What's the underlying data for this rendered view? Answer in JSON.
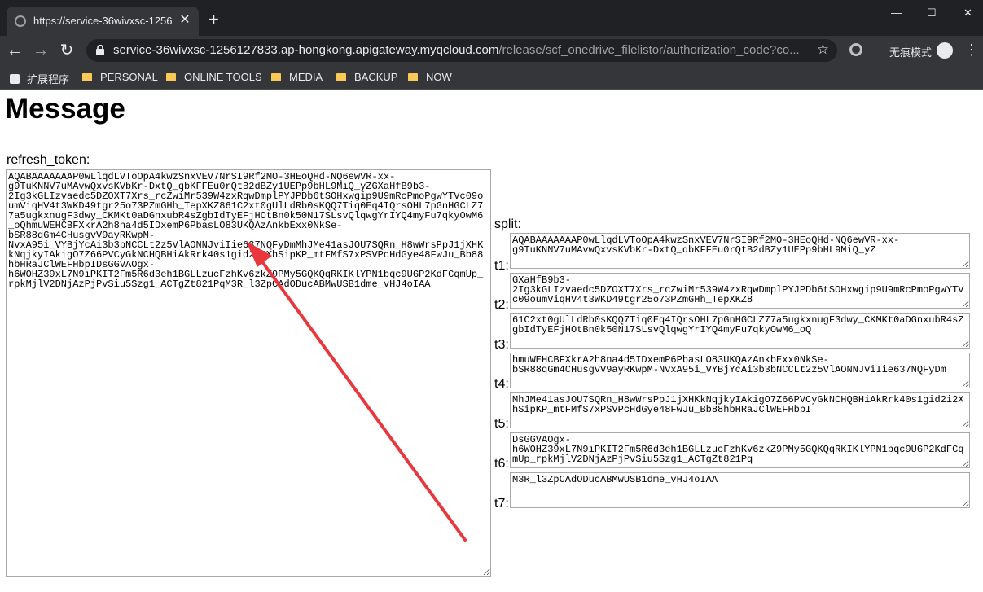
{
  "browser": {
    "tab_title": "https://service-36wivxsc-1256",
    "url_host": "service-36wivxsc-1256127833.ap-hongkong.apigateway.myqcloud.com",
    "url_path": "/release/scf_onedrive_filelistor/authorization_code?co...",
    "incognito_label": "无痕模式",
    "bookmarks": [
      "扩展程序",
      "PERSONAL",
      "ONLINE TOOLS",
      "MEDIA",
      "BACKUP",
      "NOW"
    ]
  },
  "page": {
    "heading": "Message",
    "refresh_label": "refresh_token:",
    "refresh_token": "AQABAAAAAAAP0wLlqdLVToOpA4kwzSnxVEV7NrSI9Rf2MO-3HEoQHd-NQ6ewVR-xx-g9TuKNNV7uMAvwQxvsKVbKr-DxtQ_qbKFFEu0rQtB2dBZy1UEPp9bHL9MiQ_yZGXaHfB9b3-2Ig3kGLIzvaedc5DZOXT7Xrs_rcZwiMr539W4zxRqwDmplPYJPDb6tSOHxwgip9U9mRcPmoPgwYTVc09oumViqHV4t3WKD49tgr25o73PZmGHh_TepXKZ861C2xt0gUlLdRb0sKQQ7Tiq0Eq4IQrsOHL7pGnHGCLZ77a5ugkxnugF3dwy_CKMKt0aDGnxubR4sZgbIdTyEFjHOtBn0k50N17SLsvQlqwgYrIYQ4myFu7qkyOwM6_oQhmuWEHCBFXkrA2h8na4d5IDxemP6PbasLO83UKQAzAnkbExx0NkSe-bSR88qGm4CHusgvV9ayRKwpM-NvxA95i_VYBjYcAi3b3bNCCLt2z5VlAONNJviIie637NQFyDmMhJMe41asJOU7SQRn_H8wWrsPpJ1jXHKkNqjkyIAkigO7Z66PVCyGkNCHQBHiAkRrk40s1gid2i2XhSipKP_mtFMfS7xPSVPcHdGye48FwJu_Bb88hbHRaJClWEFHbpIDsGGVAOgx-h6WOHZ39xL7N9iPKIT2Fm5R6d3eh1BGLLzucFzhKv6zkZ9PMy5GQKQqRKIKlYPN1bqc9UGP2KdFCqmUp_rpkMjlV2DNjAzPjPvSiu5Szg1_ACTgZt821PqM3R_l3ZpCAdODucABMwUSB1dme_vHJ4oIAA",
    "split_label": "split:",
    "splits": [
      {
        "label": "t1:",
        "value": "AQABAAAAAAAP0wLlqdLVToOpA4kwzSnxVEV7NrSI9Rf2MO-3HEoQHd-NQ6ewVR-xx-g9TuKNNV7uMAvwQxvsKVbKr-DxtQ_qbKFFEu0rQtB2dBZy1UEPp9bHL9MiQ_yZ"
      },
      {
        "label": "t2:",
        "value": "GXaHfB9b3-2Ig3kGLIzvaedc5DZOXT7Xrs_rcZwiMr539W4zxRqwDmplPYJPDb6tSOHxwgip9U9mRcPmoPgwYTVc09oumViqHV4t3WKD49tgr25o73PZmGHh_TepXKZ8"
      },
      {
        "label": "t3:",
        "value": "61C2xt0gUlLdRb0sKQQ7Tiq0Eq4IQrsOHL7pGnHGCLZ77a5ugkxnugF3dwy_CKMKt0aDGnxubR4sZgbIdTyEFjHOtBn0k50N17SLsvQlqwgYrIYQ4myFu7qkyOwM6_oQ"
      },
      {
        "label": "t4:",
        "value": "hmuWEHCBFXkrA2h8na4d5IDxemP6PbasLO83UKQAzAnkbExx0NkSe-bSR88qGm4CHusgvV9ayRKwpM-NvxA95i_VYBjYcAi3b3bNCCLt2z5VlAONNJviIie637NQFyDm"
      },
      {
        "label": "t5:",
        "value": "MhJMe41asJOU7SQRn_H8wWrsPpJ1jXHKkNqjkyIAkigO7Z66PVCyGkNCHQBHiAkRrk40s1gid2i2XhSipKP_mtFMfS7xPSVPcHdGye48FwJu_Bb88hbHRaJClWEFHbpI"
      },
      {
        "label": "t6:",
        "value": "DsGGVAOgx-h6WOHZ39xL7N9iPKIT2Fm5R6d3eh1BGLLzucFzhKv6zkZ9PMy5GQKQqRKIKlYPN1bqc9UGP2KdFCqmUp_rpkMjlV2DNjAzPjPvSiu5Szg1_ACTgZt821Pq"
      },
      {
        "label": "t7:",
        "value": "M3R_l3ZpCAdODucABMwUSB1dme_vHJ4oIAA"
      }
    ]
  },
  "colors": {
    "arrow": "#e8383d",
    "chrome_dark": "#202124",
    "chrome_mid": "#35363a"
  }
}
